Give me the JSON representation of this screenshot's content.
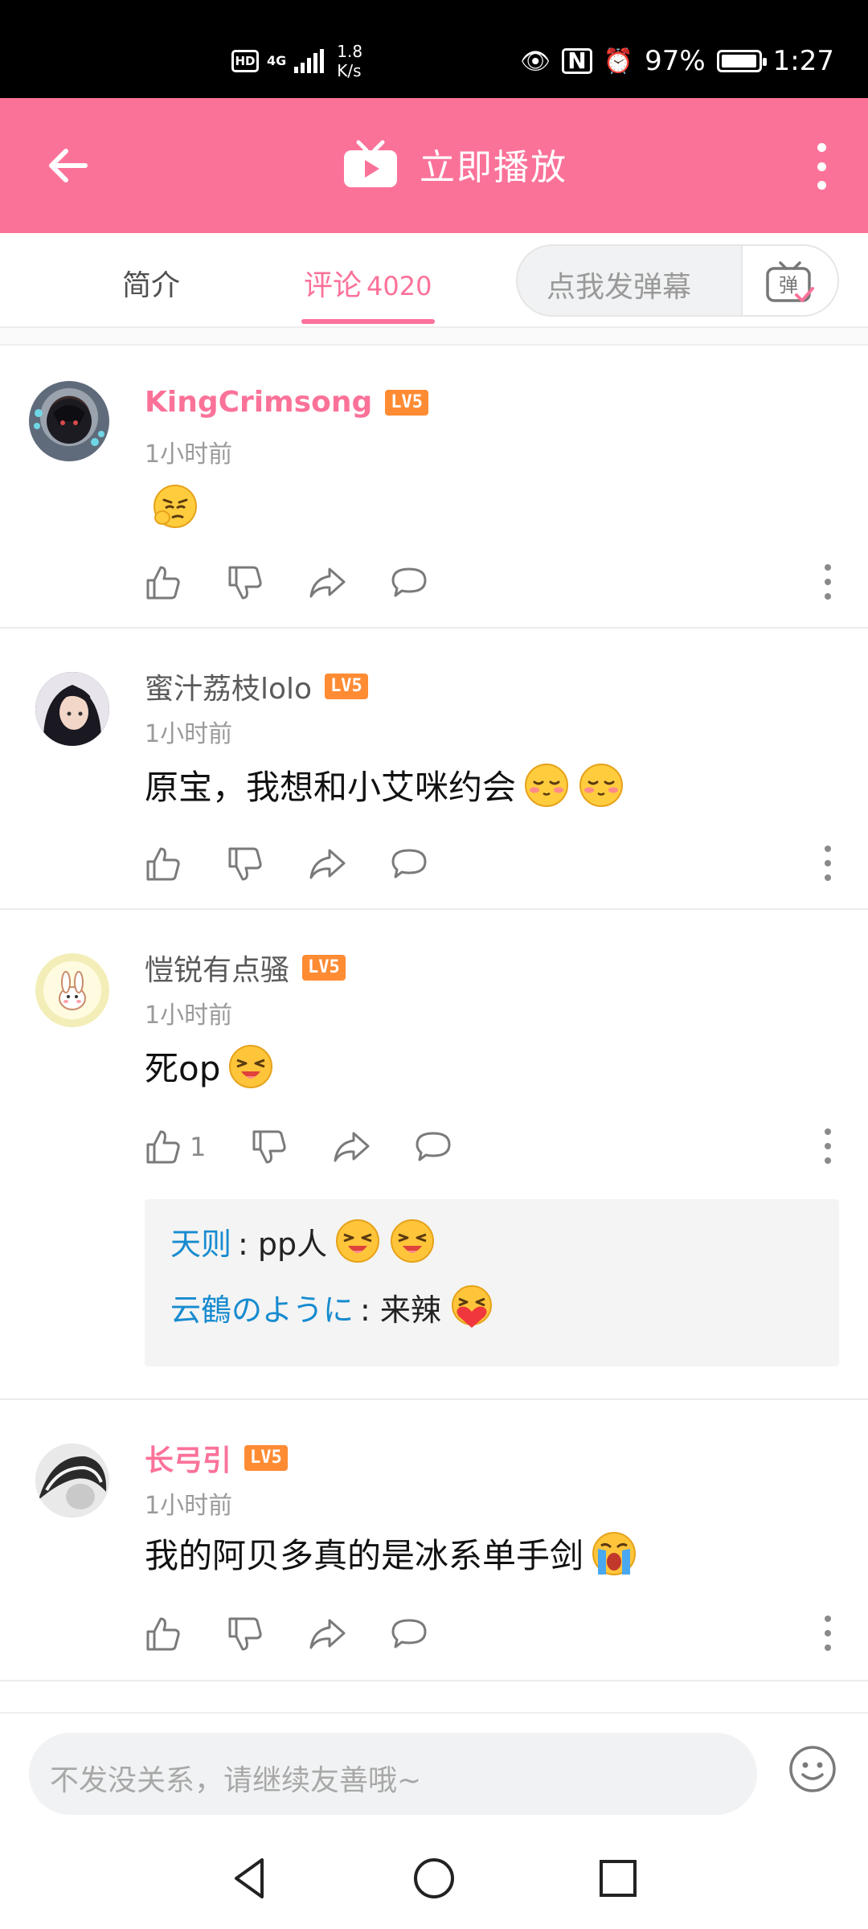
{
  "status_bar": {
    "hd": "HD",
    "network": "4G",
    "speed_value": "1.8",
    "speed_unit": "K/s",
    "battery": "97%",
    "battery_level": 0.97,
    "time": "1:27"
  },
  "header": {
    "title": "立即播放",
    "accent": "#fb7299"
  },
  "tabs": {
    "intro": "简介",
    "comments": "评论",
    "comments_count": "4020",
    "danmaku_placeholder": "点我发弹幕",
    "danmaku_button": "弹"
  },
  "comments": [
    {
      "user": "KingCrimsong",
      "level": "LV5",
      "time": "1小时前",
      "text": "",
      "emoji_count": 1,
      "likes": ""
    },
    {
      "user": "蜜汁荔枝lolo",
      "level": "LV5",
      "time": "1小时前",
      "text": "原宝，我想和小艾咪约会",
      "emoji_count": 2,
      "likes": ""
    },
    {
      "user": "愷锐有点骚",
      "level": "LV5",
      "time": "1小时前",
      "text": "死op",
      "emoji_count": 1,
      "likes": "1",
      "replies": [
        {
          "name": "天则",
          "text": ": pp人"
        },
        {
          "name": "云鶴のように",
          "text": ": 来辣"
        }
      ]
    },
    {
      "user": "长弓引",
      "level": "LV5",
      "time": "1小时前",
      "text": "我的阿贝多真的是冰系单手剑",
      "emoji_count": 1,
      "likes": ""
    }
  ],
  "input": {
    "placeholder": "不发没关系，请继续友善哦~"
  },
  "icons": {
    "back": "arrow-left-icon",
    "play": "tv-play-icon",
    "more": "more-vertical-icon",
    "like": "thumb-up-icon",
    "dislike": "thumb-down-icon",
    "share": "share-icon",
    "reply": "comment-bubble-icon",
    "emoji": "emoji-face-icon"
  }
}
